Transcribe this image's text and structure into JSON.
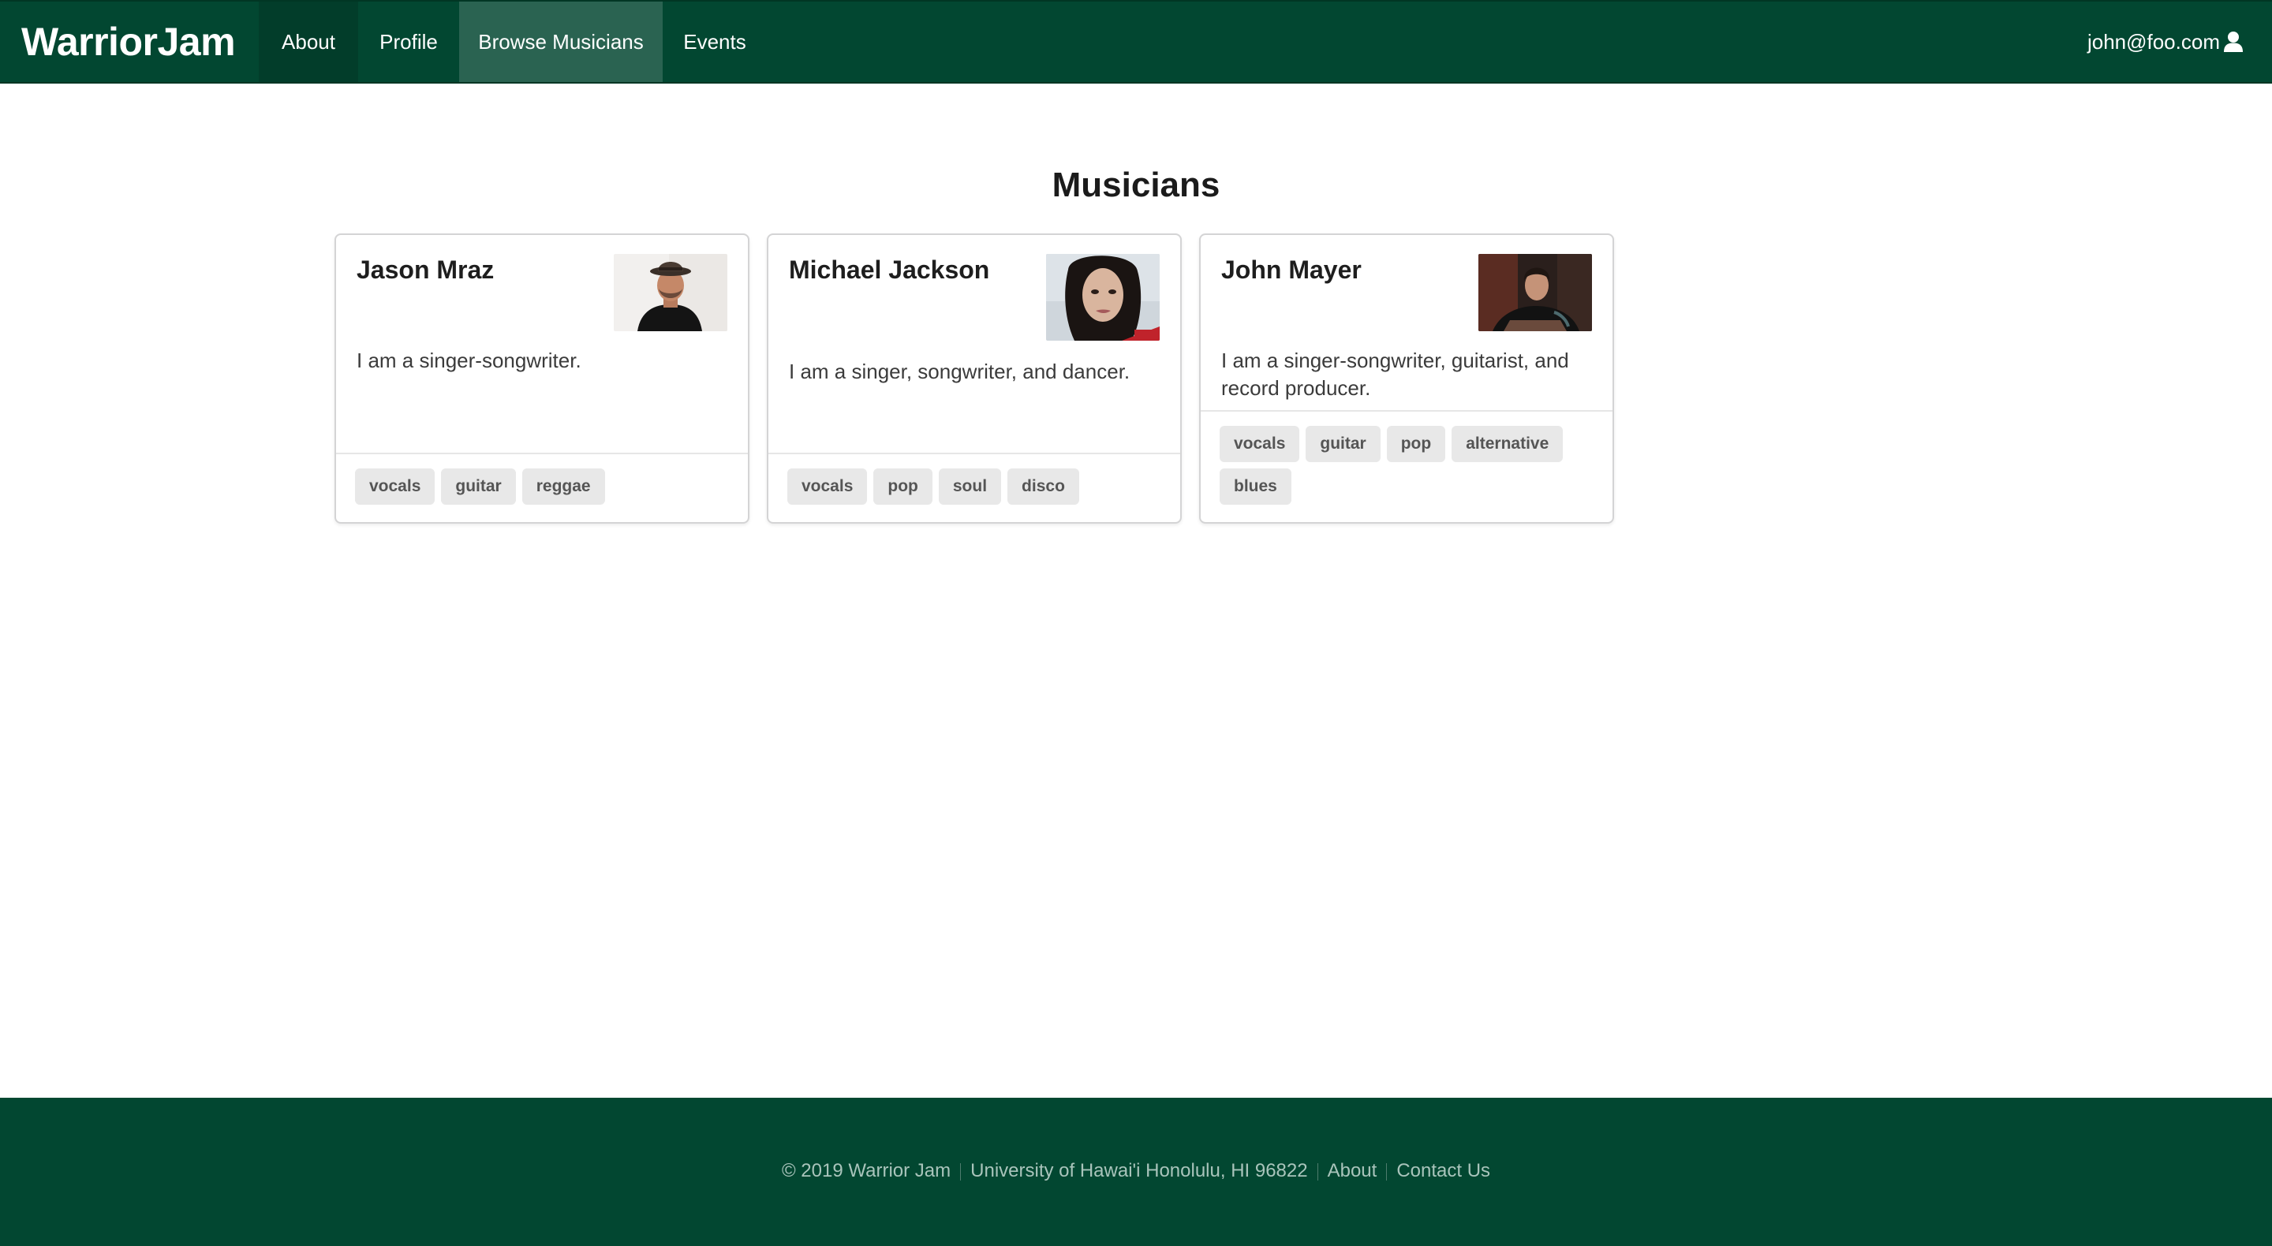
{
  "nav": {
    "brand": "WarriorJam",
    "items": [
      {
        "label": "About"
      },
      {
        "label": "Profile"
      },
      {
        "label": "Browse Musicians",
        "active": true
      },
      {
        "label": "Events"
      }
    ],
    "user": "john@foo.com",
    "user_icon": "user-icon"
  },
  "main": {
    "title": "Musicians",
    "cards": [
      {
        "name": "Jason Mraz",
        "description": "I am a singer-songwriter.",
        "tags": [
          "vocals",
          "guitar",
          "reggae"
        ]
      },
      {
        "name": "Michael Jackson",
        "description": "I am a singer, songwriter, and dancer.",
        "tags": [
          "vocals",
          "pop",
          "soul",
          "disco"
        ]
      },
      {
        "name": "John Mayer",
        "description": "I am a singer-songwriter, guitarist, and record producer.",
        "tags": [
          "vocals",
          "guitar",
          "pop",
          "alternative",
          "blues"
        ]
      }
    ]
  },
  "footer": {
    "copyright": "© 2019 Warrior Jam",
    "address": "University of Hawai'i Honolulu, HI 96822",
    "about": "About",
    "contact": "Contact Us"
  },
  "colors": {
    "nav_bg": "#024731",
    "nav_active": "#2a6351",
    "footer_bg": "#024731",
    "tag_bg": "#e8e8e8"
  }
}
